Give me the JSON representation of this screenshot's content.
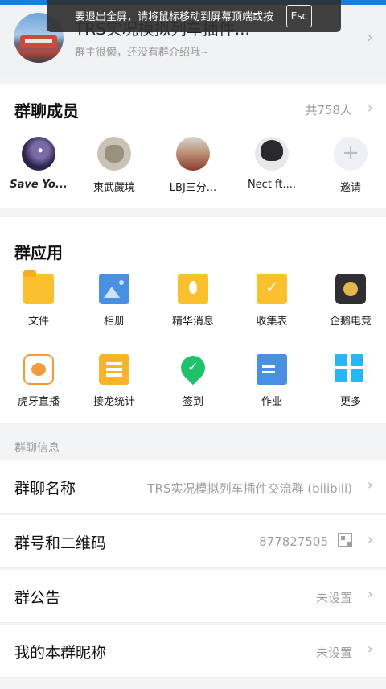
{
  "fullscreen_hint": {
    "text": "要退出全屏，请将鼠标移动到屏幕顶端或按",
    "key": "Esc"
  },
  "group": {
    "name": "TRS实况模拟列车插件...",
    "intro": "群主很懒，还没有群介绍哦~"
  },
  "members": {
    "title": "群聊成员",
    "count_label": "共758人",
    "items": [
      {
        "name": "Save Yo..."
      },
      {
        "name": "東武藏境"
      },
      {
        "name": "LBJ三分..."
      },
      {
        "name": "Nect ft...."
      },
      {
        "name": "邀请"
      }
    ]
  },
  "apps": {
    "title": "群应用",
    "items": [
      {
        "label": "文件",
        "icon": "folder-icon"
      },
      {
        "label": "相册",
        "icon": "photo-album-icon"
      },
      {
        "label": "精华消息",
        "icon": "essence-message-icon"
      },
      {
        "label": "收集表",
        "icon": "collection-form-icon"
      },
      {
        "label": "企鹅电竞",
        "icon": "penguin-esports-icon"
      },
      {
        "label": "虎牙直播",
        "icon": "huya-live-icon"
      },
      {
        "label": "接龙统计",
        "icon": "chain-stats-icon"
      },
      {
        "label": "签到",
        "icon": "check-in-icon"
      },
      {
        "label": "作业",
        "icon": "homework-icon"
      },
      {
        "label": "更多",
        "icon": "more-grid-icon"
      }
    ]
  },
  "info": {
    "section_label": "群聊信息",
    "name_key": "群聊名称",
    "name_value": "TRS实况模拟列车插件交流群 (bilibili)",
    "id_key": "群号和二维码",
    "id_value": "877827505",
    "notice_key": "群公告",
    "notice_value": "未设置",
    "nickname_key": "我的本群昵称",
    "nickname_value": "未设置"
  },
  "colors": {
    "accent_blue": "#1e7cd8",
    "folder_yellow": "#fbc02d",
    "album_blue": "#4a90e2",
    "checkin_green": "#1fc16b",
    "more_cyan": "#29b6f6"
  }
}
